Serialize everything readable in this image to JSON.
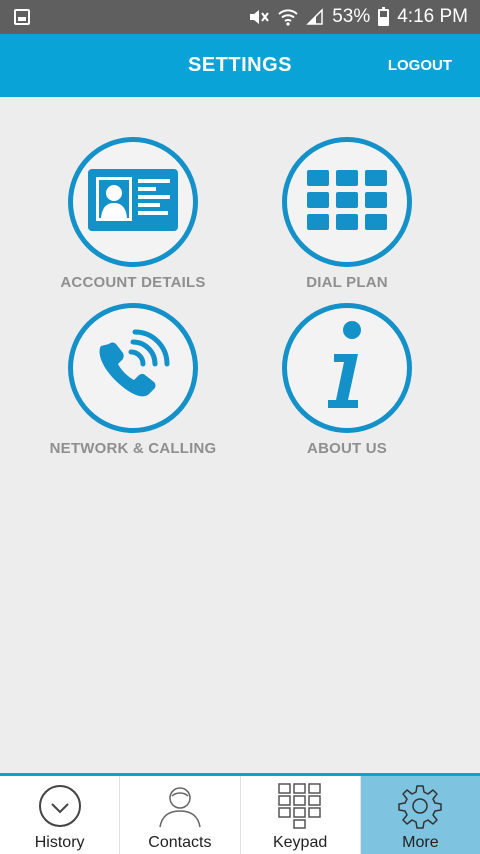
{
  "status_bar": {
    "battery": "53%",
    "time": "4:16 PM"
  },
  "header": {
    "title": "SETTINGS",
    "logout_label": "LOGOUT"
  },
  "menu": {
    "account_details": "ACCOUNT DETAILS",
    "dial_plan": "DIAL PLAN",
    "network_calling": "NETWORK & CALLING",
    "about_us": "ABOUT US"
  },
  "bottom_nav": {
    "history": "History",
    "contacts": "Contacts",
    "keypad": "Keypad",
    "more": "More"
  },
  "colors": {
    "accent": "#0aa3d8",
    "icon_blue": "#1391c8",
    "active_tab": "#7ec3df"
  }
}
